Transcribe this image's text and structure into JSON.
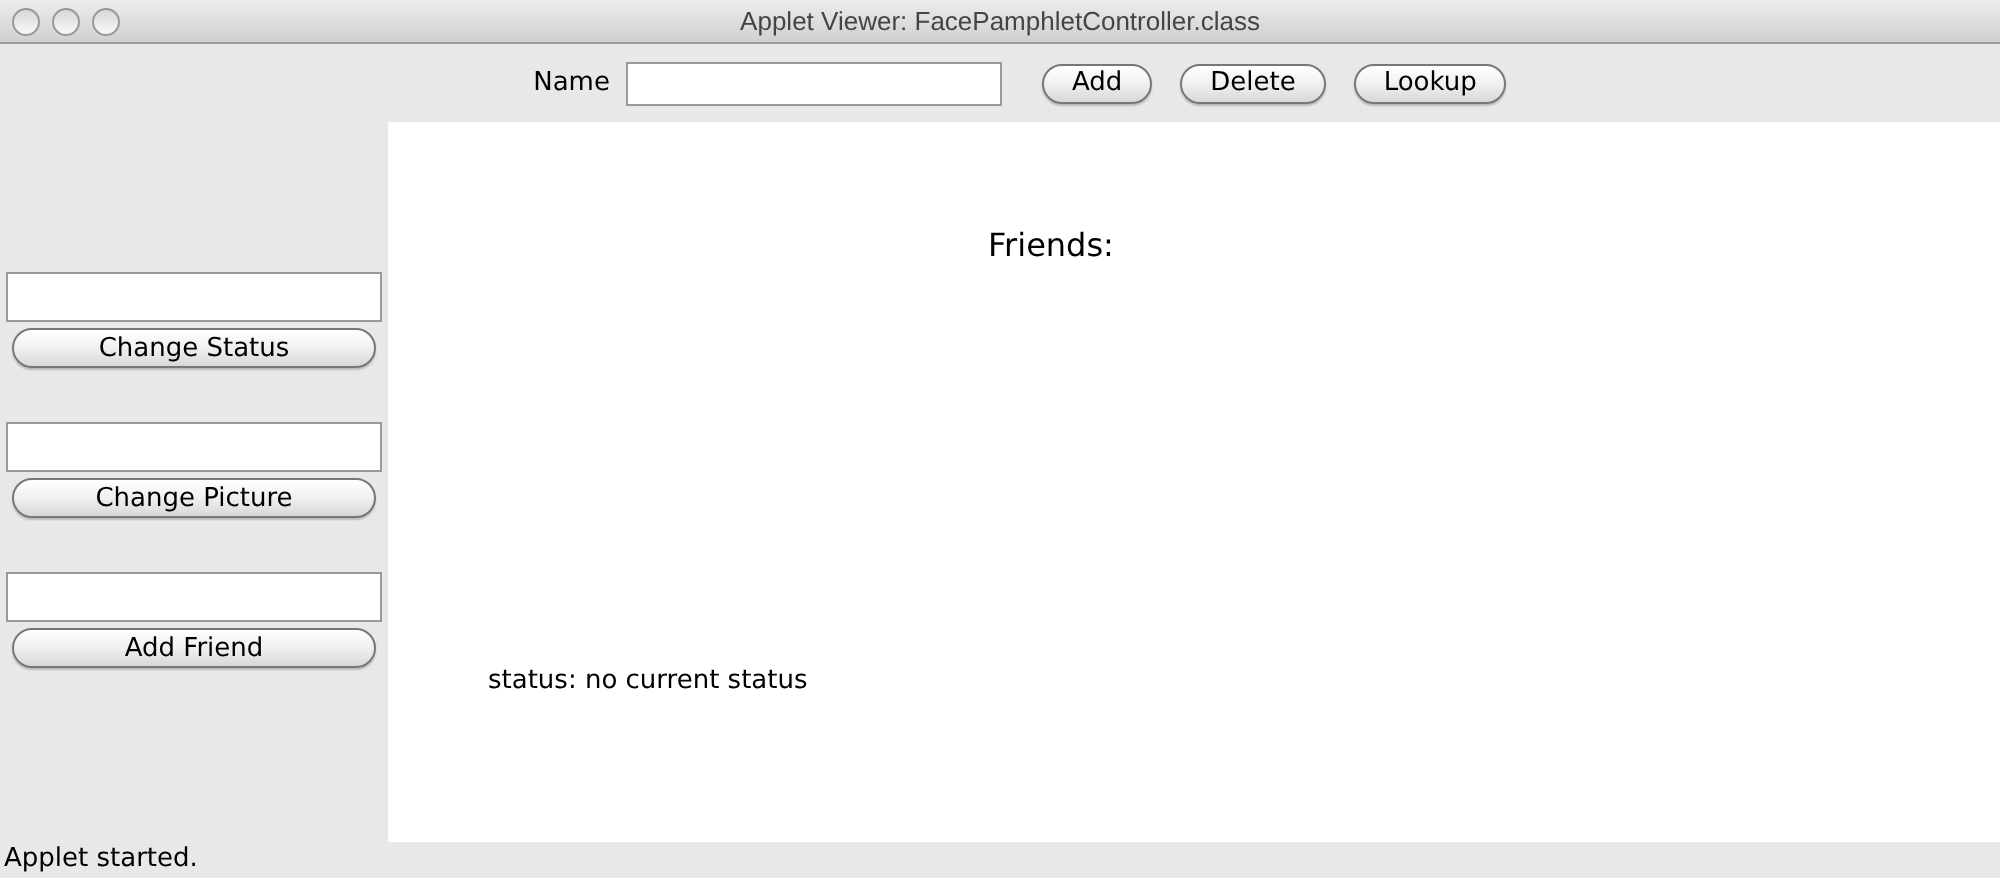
{
  "window": {
    "title": "Applet Viewer: FacePamphletController.class"
  },
  "toolbar": {
    "name_label": "Name",
    "buttons": [
      "Add",
      "Delete",
      "Lookup"
    ]
  },
  "sidebar": [
    {
      "button": "Change Status"
    },
    {
      "button": "Change Picture"
    },
    {
      "button": "Add Friend"
    }
  ],
  "canvas": {
    "friends_heading": "Friends:",
    "status": "status: no current status"
  },
  "status_bar": "Applet started."
}
